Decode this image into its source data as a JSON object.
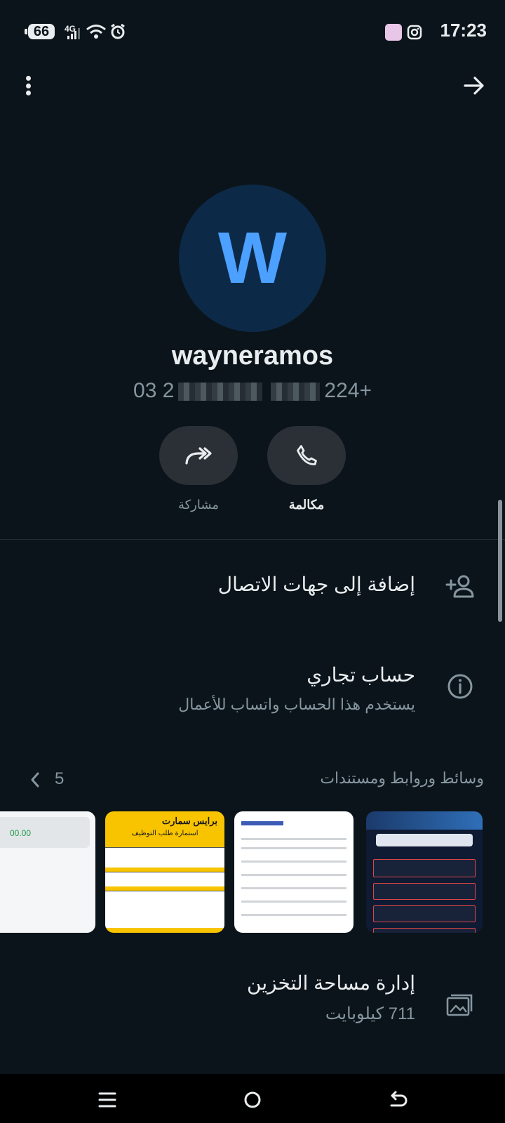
{
  "status_bar": {
    "battery": "66",
    "network": "4G",
    "time": "17:23"
  },
  "profile": {
    "avatar_letter": "W",
    "avatar_color": "#0c2a48",
    "avatar_text_color": "#4ca0ff",
    "name": "wayneramos",
    "phone_start": "03 2",
    "phone_end": "224+"
  },
  "actions": {
    "share_label": "مشاركة",
    "call_label": "مكالمة"
  },
  "add_contact": {
    "label": "إضافة إلى جهات الاتصال"
  },
  "business": {
    "title": "حساب تجاري",
    "subtitle": "يستخدم هذا الحساب واتساب للأعمال"
  },
  "media": {
    "title": "وسائط وروابط ومستندات",
    "count": "5",
    "thumbs": [
      {
        "name": "login-screenshot"
      },
      {
        "name": "details-screenshot"
      },
      {
        "name": "job-application-form",
        "title": "برايس سمارت",
        "subtitle": "استمارة طلب التوظيف"
      },
      {
        "name": "transaction-receipt",
        "amount": "00.00"
      }
    ]
  },
  "storage": {
    "title": "إدارة مساحة التخزين",
    "size": "711 كيلوبايت"
  }
}
